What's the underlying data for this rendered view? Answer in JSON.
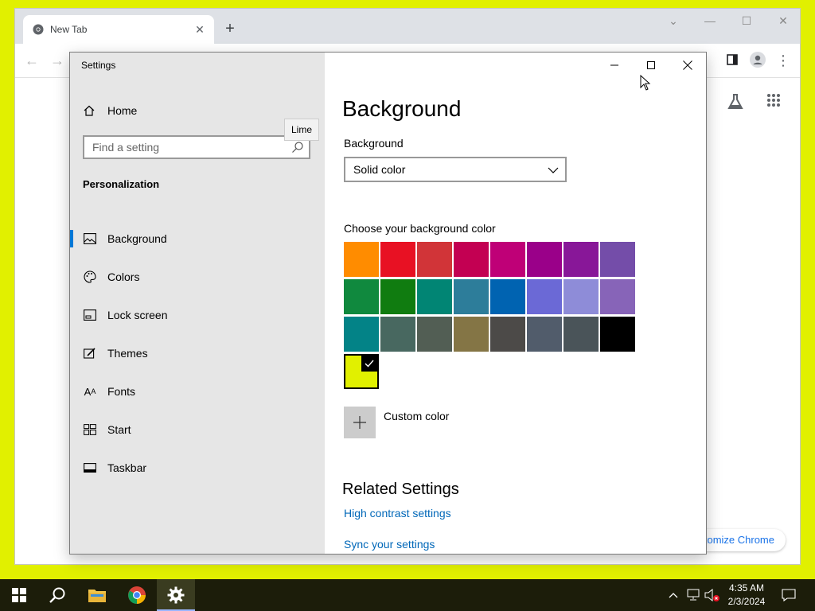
{
  "chrome": {
    "tab_title": "New Tab",
    "customize_label": "ustomize Chrome"
  },
  "settings": {
    "app_title": "Settings",
    "home_label": "Home",
    "search_placeholder": "Find a setting",
    "section_title": "Personalization",
    "tooltip": "Lime",
    "nav": [
      {
        "label": "Background",
        "icon": "picture-icon",
        "active": true
      },
      {
        "label": "Colors",
        "icon": "palette-icon",
        "active": false
      },
      {
        "label": "Lock screen",
        "icon": "lock-screen-icon",
        "active": false
      },
      {
        "label": "Themes",
        "icon": "themes-brush-icon",
        "active": false
      },
      {
        "label": "Fonts",
        "icon": "fonts-icon",
        "active": false
      },
      {
        "label": "Start",
        "icon": "start-grid-icon",
        "active": false
      },
      {
        "label": "Taskbar",
        "icon": "taskbar-icon",
        "active": false
      }
    ],
    "main": {
      "page_title": "Background",
      "background_label": "Background",
      "background_value": "Solid color",
      "choose_label": "Choose your background color",
      "swatch_rows": [
        [
          "#ff8c00",
          "#e81123",
          "#d13438",
          "#c30052",
          "#bf0077",
          "#9a0089",
          "#881798",
          "#744da9"
        ],
        [
          "#10893e",
          "#107c10",
          "#018574",
          "#2d7d9a",
          "#0063b1",
          "#6b69d6",
          "#8e8cd8",
          "#8764b8"
        ],
        [
          "#038387",
          "#486860",
          "#525e54",
          "#847545",
          "#4c4a48",
          "#515c6b",
          "#4a5459",
          "#000000"
        ],
        [
          "#e1f000"
        ]
      ],
      "selected_color": "#e1f000",
      "custom_color_label": "Custom color",
      "related_title": "Related Settings",
      "links": [
        "High contrast settings",
        "Sync your settings"
      ]
    }
  },
  "taskbar": {
    "time": "4:35 AM",
    "date": "2/3/2024"
  },
  "colors": {
    "desktop": "#e1f000",
    "accent": "#0078d7",
    "link": "#0067b8"
  }
}
